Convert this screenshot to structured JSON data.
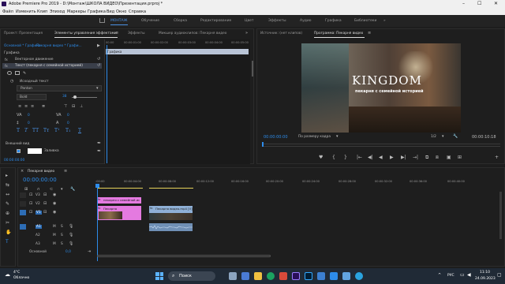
{
  "titlebar": {
    "title": "Adobe Premiere Pro 2019 - D:\\Монтаж\\ШКОЛА ВИДЕО\\Презентация.prproj *",
    "min": "–",
    "max": "☐",
    "close": "✕"
  },
  "menu": [
    "Файл",
    "Изменить",
    "Клип",
    "Эпизод",
    "Маркеры",
    "Графика",
    "Вид",
    "Окно",
    "Справка"
  ],
  "workspaces": [
    "МОНТАЖ",
    "Обучение",
    "Сборка",
    "Редактирование",
    "Цвет",
    "Эффекты",
    "Аудио",
    "Графика",
    "Библиотеки"
  ],
  "workspaces_more": "»",
  "left_panel": {
    "tabs": [
      "Проект: Презентация",
      "Элементы управления эффектами",
      "Эффекты",
      "Микшер аудиоклипов: Пекарня видео"
    ],
    "menu_icon": "≡",
    "more": "»",
    "source_label": "Основной * Графика",
    "source_clip": "Пекарня видео * Графи...",
    "section_label": "Графика",
    "effects": [
      "Векторное движение",
      "Текст (пекарня с семейной историей)"
    ],
    "text_item": "Исходный текст",
    "font": "Panton",
    "style": "Bold",
    "size": "38",
    "appearance_label": "Внешний вид",
    "fill_label": "Заливка",
    "timecode": "00:00:00:00",
    "graphic_clip_label": "Графика",
    "ruler": [
      "00:00",
      "00:00:01:00",
      "00:00:02:00",
      "00:00:03:00",
      "00:00:04:00",
      "00:00:05:00"
    ]
  },
  "program": {
    "source_tab": "Источник: (нет клипов)",
    "program_tab": "Программа: Пекарня видео",
    "title_overlay": "KINGDOM",
    "subtitle_overlay": "пекарня с семейной историей",
    "timecode_left": "00:00:00:00",
    "fit": "По размеру кадра",
    "quality": "1/2",
    "timecode_right": "00:00:10:18",
    "transport": [
      "♥",
      "{",
      "}",
      "|←",
      "◀|",
      "◀",
      "▶",
      "▶|",
      "→|",
      "⧉",
      "⧈",
      "▣",
      "⊞"
    ],
    "add": "+"
  },
  "timeline": {
    "tab": "Пекарня видео",
    "timecode": "00:00:00:00",
    "ruler": [
      ":00:00",
      "00:00:04:00",
      "00:00:08:00",
      "00:00:12:00",
      "00:00:16:00",
      "00:00:20:00",
      "00:00:24:00",
      "00:00:28:00",
      "00:00:32:00",
      "00:00:36:00",
      "00:00:40:00"
    ],
    "tracks_video": [
      "V3",
      "V2",
      "V1"
    ],
    "tracks_audio": [
      "A1",
      "A2",
      "A3"
    ],
    "master": "Основной",
    "master_val": "0,0",
    "clips": {
      "title_clip": "пекарня с семейной ис",
      "graphic_clip": "Пекарня",
      "video_clip": "Пекарня видео.mp4 [V]",
      "fx": "fx"
    },
    "tools": [
      "▸",
      "⇆",
      "↔",
      "✎",
      "⊕",
      "✂",
      "✋",
      "T"
    ]
  },
  "taskbar": {
    "weather_temp": "4°C",
    "weather_desc": "Облачно",
    "search": "Поиск",
    "lang": "РУС",
    "time": "11:10",
    "date": "24.09.2023"
  }
}
